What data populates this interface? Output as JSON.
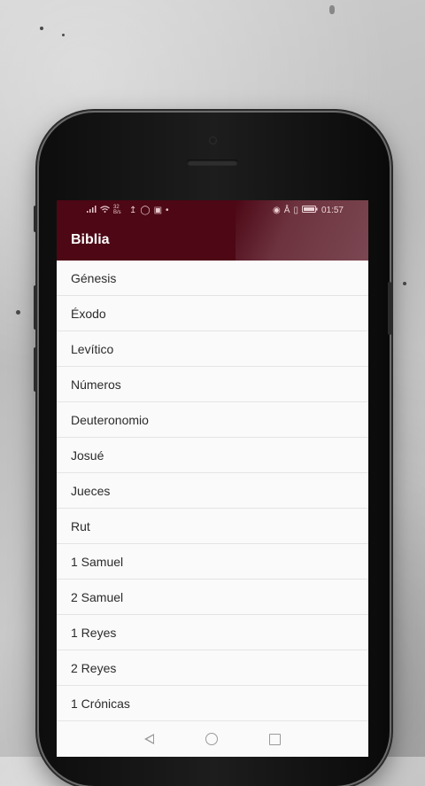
{
  "status_bar": {
    "left_indicators": "32 B/s",
    "time": "01:57",
    "icons": [
      "signal-icon",
      "wifi-icon",
      "upload-icon",
      "instagram-icon",
      "image-icon",
      "dot-icon",
      "eye-icon",
      "bluetooth-icon",
      "vibrate-icon",
      "battery-icon"
    ]
  },
  "app_bar": {
    "title": "Biblia",
    "color": "#4d0715"
  },
  "books": [
    "Génesis",
    "Éxodo",
    "Levítico",
    "Números",
    "Deuteronomio",
    "Josué",
    "Jueces",
    "Rut",
    "1 Samuel",
    "2 Samuel",
    "1 Reyes",
    "2 Reyes",
    "1 Crónicas"
  ],
  "nav_bar": {
    "icons": [
      "back-icon",
      "home-icon",
      "recent-apps-icon"
    ]
  }
}
